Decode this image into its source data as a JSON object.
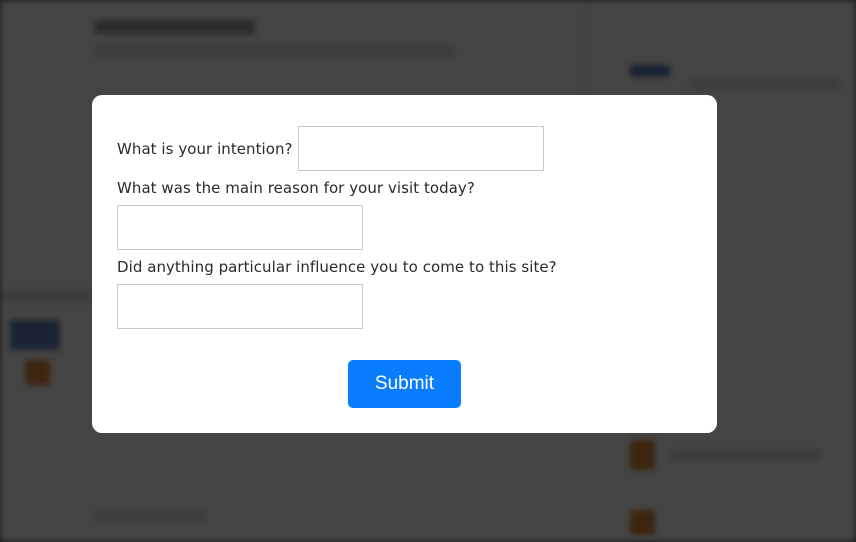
{
  "survey": {
    "question_1": {
      "label": "What is your intention?",
      "value": ""
    },
    "question_2": {
      "label": "What was the main reason for your visit today?",
      "value": ""
    },
    "question_3": {
      "label": "Did anything particular influence you to come to this site?",
      "value": ""
    },
    "submit_label": "Submit"
  },
  "colors": {
    "submit_button": "#0a7dff",
    "overlay": "rgba(0,0,0,0.72)",
    "modal_background": "#ffffff"
  }
}
